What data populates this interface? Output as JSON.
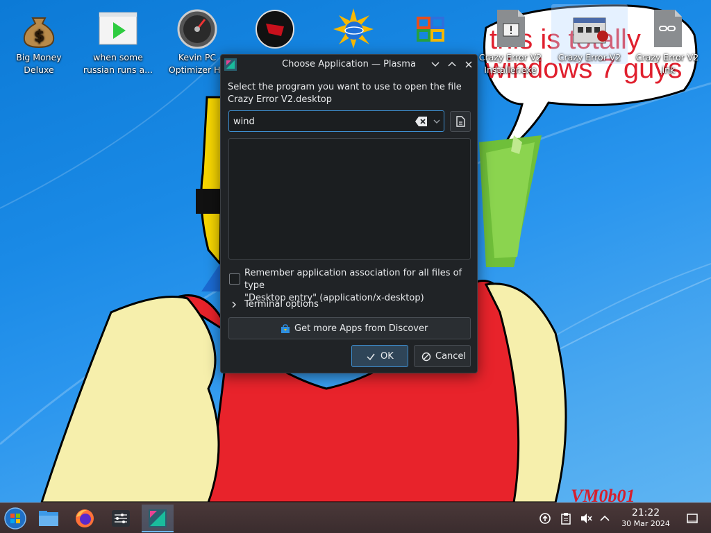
{
  "desktop": {
    "icons": [
      {
        "label": "Big Money Deluxe",
        "icon": "money-bag-icon"
      },
      {
        "label": "when some russian runs a...",
        "icon": "video-file-icon"
      },
      {
        "label": "Kevin PC Optimizer Ho",
        "icon": "speedometer-icon"
      },
      {
        "label": "",
        "icon": "red-dark-app-icon"
      },
      {
        "label": "",
        "icon": "sun-globe-icon"
      },
      {
        "label": "",
        "icon": "colorful-grid-icon"
      },
      {
        "label": "Crazy Error V2 Installer.exe",
        "icon": "exe-file-icon"
      },
      {
        "label": "Crazy Error V2",
        "icon": "crazy-error-app-icon"
      },
      {
        "label": "Crazy Error V2 .lnk",
        "icon": "link-file-icon"
      }
    ],
    "wallpaper_text_line1": "this is totally",
    "wallpaper_text_line2": "windows 7 guys",
    "watermark": "VM0b01"
  },
  "dialog": {
    "title": "Choose Application — Plasma",
    "prompt_line1": "Select the program you want to use to open the file",
    "prompt_line2": "Crazy Error V2.desktop",
    "search_value": "wind",
    "remember_line1": "Remember application association for all files of type",
    "remember_line2": "\"Desktop entry\" (application/x-desktop)",
    "remember_checked": false,
    "terminal_options": "Terminal options",
    "discover_button": "Get more Apps from Discover",
    "ok_button": "OK",
    "cancel_button": "Cancel"
  },
  "taskbar": {
    "items": [
      "start-orb-icon",
      "file-manager-icon",
      "firefox-icon",
      "settings-icon",
      "plasma-app-icon"
    ],
    "active_index": 4,
    "tray": [
      "updates-icon",
      "clipboard-icon",
      "volume-muted-icon",
      "expand-tray-icon"
    ],
    "time": "21:22",
    "date": "30 Mar 2024"
  },
  "colors": {
    "accent": "#3d8fd1",
    "dialog_bg": "#202326",
    "wallpaper_text": "#e0202e"
  }
}
